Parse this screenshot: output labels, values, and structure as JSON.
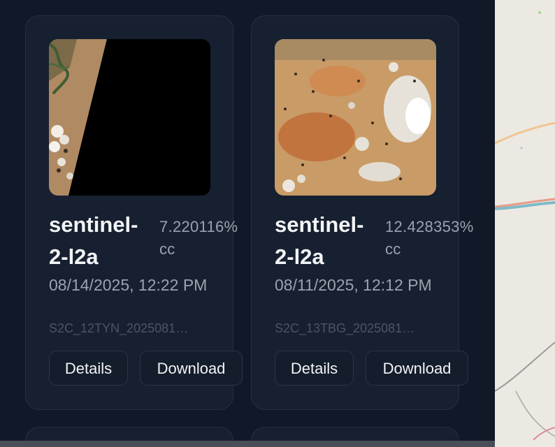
{
  "cards": [
    {
      "collection": "sentinel-2-l2a",
      "cloud_cover": "7.220116% cc",
      "datetime": "08/14/2025, 12:22 PM",
      "scene_id": "S2C_12TYN_2025081…",
      "details_label": "Details",
      "download_label": "Download"
    },
    {
      "collection": "sentinel-2-l2a",
      "cloud_cover": "12.428353% cc",
      "datetime": "08/11/2025, 12:12 PM",
      "scene_id": "S2C_13TBG_2025081…",
      "details_label": "Details",
      "download_label": "Download"
    }
  ]
}
